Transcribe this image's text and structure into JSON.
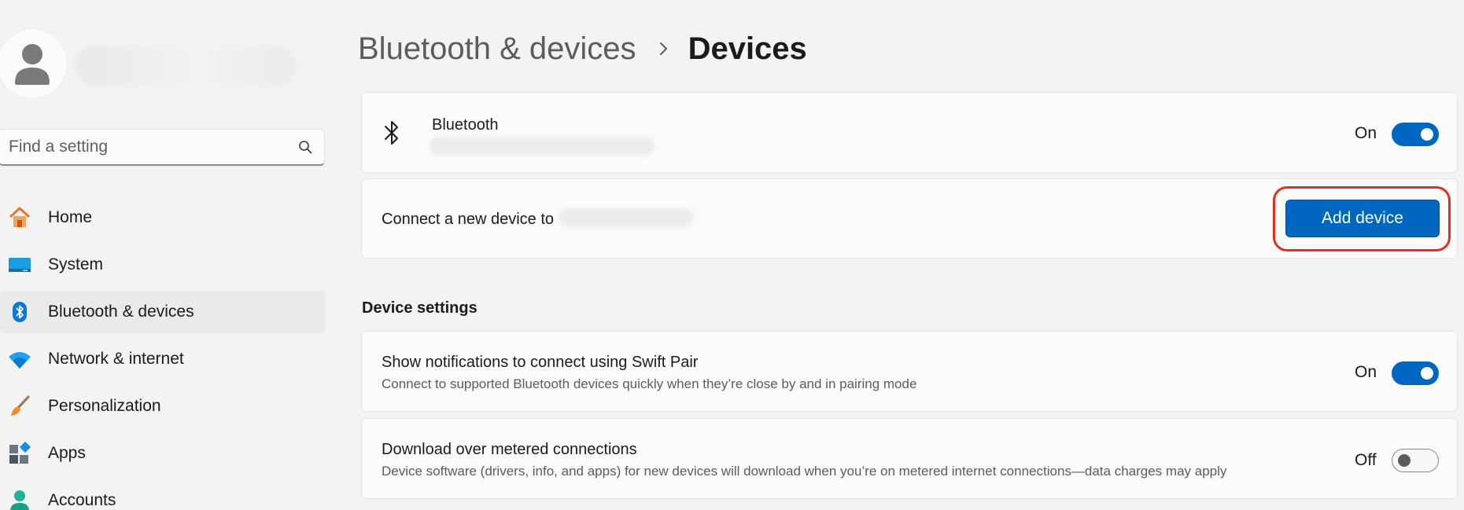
{
  "sidebar": {
    "search": {
      "placeholder": "Find a setting"
    },
    "items": [
      {
        "label": "Home"
      },
      {
        "label": "System"
      },
      {
        "label": "Bluetooth & devices"
      },
      {
        "label": "Network & internet"
      },
      {
        "label": "Personalization"
      },
      {
        "label": "Apps"
      },
      {
        "label": "Accounts"
      }
    ]
  },
  "breadcrumb": {
    "parent": "Bluetooth & devices",
    "current": "Devices"
  },
  "bluetooth_card": {
    "title": "Bluetooth",
    "state": "On"
  },
  "connect_card": {
    "text": "Connect a new device to",
    "button": "Add device"
  },
  "device_settings": {
    "header": "Device settings",
    "swift_pair": {
      "title": "Show notifications to connect using Swift Pair",
      "subtitle": "Connect to supported Bluetooth devices quickly when they’re close by and in pairing mode",
      "state": "On"
    },
    "metered": {
      "title": "Download over metered connections",
      "subtitle": "Device software (drivers, info, and apps) for new devices will download when you’re on metered internet connections—data charges may apply",
      "state": "Off"
    }
  },
  "colors": {
    "accent": "#0067c0",
    "highlight": "#e0311a"
  }
}
